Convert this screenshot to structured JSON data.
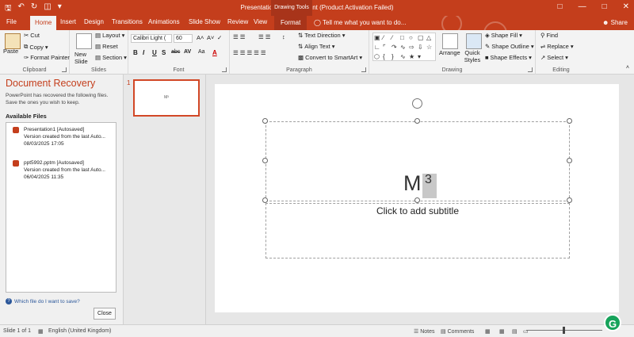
{
  "window": {
    "title": "Presentation1 - PowerPoint (Product Activation Failed)",
    "context_group": "Drawing Tools",
    "qat_icons": [
      "save-icon",
      "undo-icon",
      "redo-icon",
      "present-icon",
      "customize-qat-icon"
    ]
  },
  "tabs": [
    "File",
    "Home",
    "Insert",
    "Design",
    "Transitions",
    "Animations",
    "Slide Show",
    "Review",
    "View",
    "Format"
  ],
  "active_tab": "Home",
  "tell_me": "Tell me what you want to do...",
  "share": "Share",
  "ribbon": {
    "clipboard": {
      "label": "Clipboard",
      "paste": "Paste",
      "cut": "Cut",
      "copy": "Copy",
      "format_painter": "Format Painter"
    },
    "slides": {
      "label": "Slides",
      "new_slide": "New Slide",
      "layout": "Layout",
      "reset": "Reset",
      "section": "Section"
    },
    "font": {
      "label": "Font",
      "font_name": "Calibri Light (",
      "font_size": "60",
      "bold": "B",
      "italic": "I",
      "underline": "U",
      "shadow": "S",
      "strike": "abc",
      "spacing": "AV",
      "case": "Aa",
      "color": "A"
    },
    "paragraph": {
      "label": "Paragraph",
      "text_direction": "Text Direction",
      "align_text": "Align Text",
      "smartart": "Convert to SmartArt"
    },
    "drawing": {
      "label": "Drawing",
      "arrange": "Arrange",
      "quick_styles": "Quick Styles",
      "shape_fill": "Shape Fill",
      "shape_outline": "Shape Outline",
      "shape_effects": "Shape Effects"
    },
    "editing": {
      "label": "Editing",
      "find": "Find",
      "replace": "Replace",
      "select": "Select"
    }
  },
  "recovery": {
    "title": "Document Recovery",
    "message": "PowerPoint has recovered the following files. Save the ones you wish to keep.",
    "available": "Available Files",
    "files": [
      {
        "name": "Presentation1  [Autosaved]",
        "desc": "Version created from the last Auto...",
        "date": "08/03/2025 17:05"
      },
      {
        "name": "ppt5992.pptm  [Autosaved]",
        "desc": "Version created from the last Auto...",
        "date": "06/04/2025 11:35"
      }
    ],
    "which": "Which file do I want to save?",
    "close": "Close"
  },
  "slide_panel": {
    "number": "1",
    "thumb_text": "M³"
  },
  "slide": {
    "title_main": "M",
    "title_sup": "3",
    "subtitle": "Click to add subtitle"
  },
  "status": {
    "slide_of": "Slide 1 of 1",
    "language": "English (United Kingdom)",
    "notes": "Notes",
    "comments": "Comments",
    "badge": "G"
  },
  "colors": {
    "accent": "#c43e1c",
    "badge": "#17a35b"
  }
}
